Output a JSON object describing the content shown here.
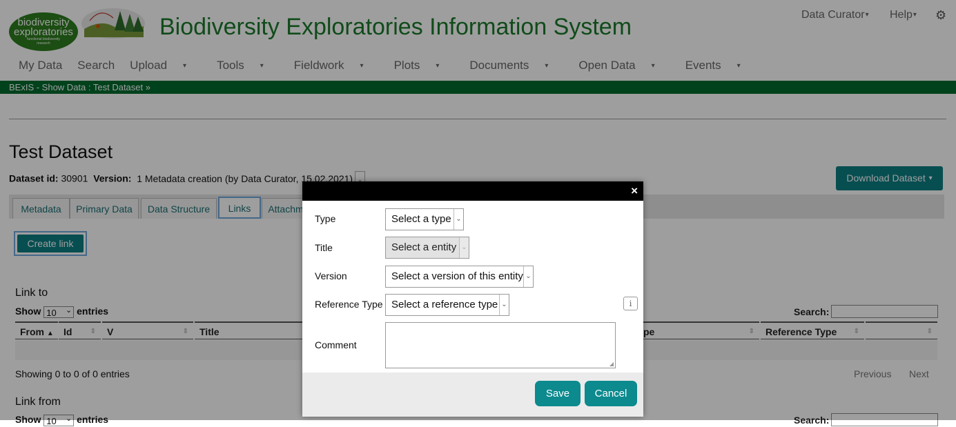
{
  "header": {
    "logo_text_1": "biodiversity",
    "logo_text_2": "exploratories",
    "logo_sub_1": "functional biodiversity",
    "logo_sub_2": "research",
    "app_title": "Biodiversity Exploratories Information System",
    "user_menu": "Data Curator",
    "help_menu": "Help"
  },
  "nav": {
    "my_data": "My Data",
    "search": "Search",
    "upload": "Upload",
    "tools": "Tools",
    "fieldwork": "Fieldwork",
    "plots": "Plots",
    "documents": "Documents",
    "open_data": "Open Data",
    "events": "Events"
  },
  "breadcrumb": "BExIS - Show Data : Test Dataset",
  "dataset": {
    "title": "Test Dataset",
    "id_label": "Dataset id:",
    "id_value": "30901",
    "version_label": "Version:",
    "version_value": "1 Metadata creation (by Data Curator, 15.02.2021)",
    "download_label": "Download Dataset"
  },
  "tabs": {
    "metadata": "Metadata",
    "primary_data": "Primary Data",
    "data_structure": "Data Structure",
    "links": "Links",
    "attachments": "Attachm"
  },
  "links_tab": {
    "create_link": "Create link",
    "link_to_title": "Link to",
    "link_from_title": "Link from",
    "show": "Show",
    "entries": "entries",
    "page_size": "10",
    "search_label": "Search:",
    "columns": {
      "from": "From",
      "id": "Id",
      "v": "V",
      "title": "Title",
      "type_partial": "pe",
      "reference_type": "Reference Type"
    },
    "info": "Showing 0 to 0 of 0 entries",
    "previous": "Previous",
    "next": "Next"
  },
  "modal": {
    "close_glyph": "×",
    "type_label": "Type",
    "type_value": "Select a type",
    "title_label": "Title",
    "title_value": "Select a entity",
    "version_label": "Version",
    "version_value": "Select a version of this entity",
    "reftype_label": "Reference Type",
    "reftype_value": "Select a reference type",
    "comment_label": "Comment",
    "info_glyph": "i",
    "save": "Save",
    "cancel": "Cancel"
  },
  "colors": {
    "brand_green": "#1b7a2a",
    "breadcrumb_bg": "#006b2e",
    "teal_button": "#0c8a8e"
  },
  "icons": [
    "gear-icon",
    "caret-down-icon",
    "double-chevron-down-icon",
    "close-icon",
    "info-icon",
    "sort-icon"
  ]
}
